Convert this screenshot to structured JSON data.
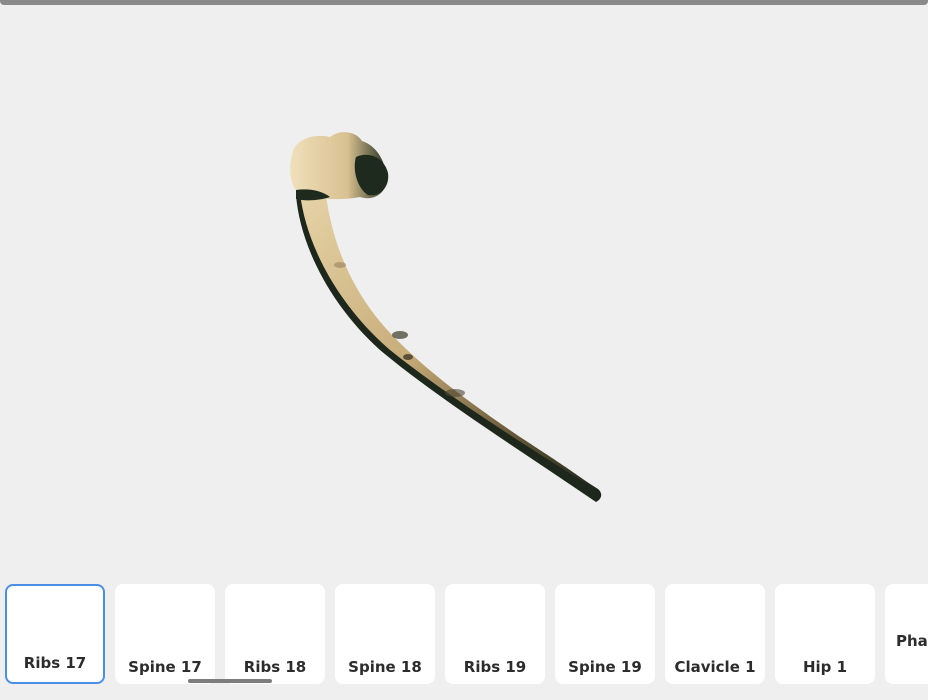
{
  "viewer": {
    "model_name": "Ribs 17"
  },
  "thumbnails": [
    {
      "label": "Ribs 17",
      "selected": true
    },
    {
      "label": "Spine 17",
      "selected": false
    },
    {
      "label": "Ribs 18",
      "selected": false
    },
    {
      "label": "Spine 18",
      "selected": false
    },
    {
      "label": "Ribs 19",
      "selected": false
    },
    {
      "label": "Spine 19",
      "selected": false
    },
    {
      "label": "Clavicle 1",
      "selected": false
    },
    {
      "label": "Hip 1",
      "selected": false
    },
    {
      "label": "Phal",
      "selected": false
    }
  ],
  "colors": {
    "background": "#efefef",
    "selected_border": "#4a8fe3",
    "bone_light": "#d9c49a",
    "bone_dark": "#1f2a1e"
  }
}
